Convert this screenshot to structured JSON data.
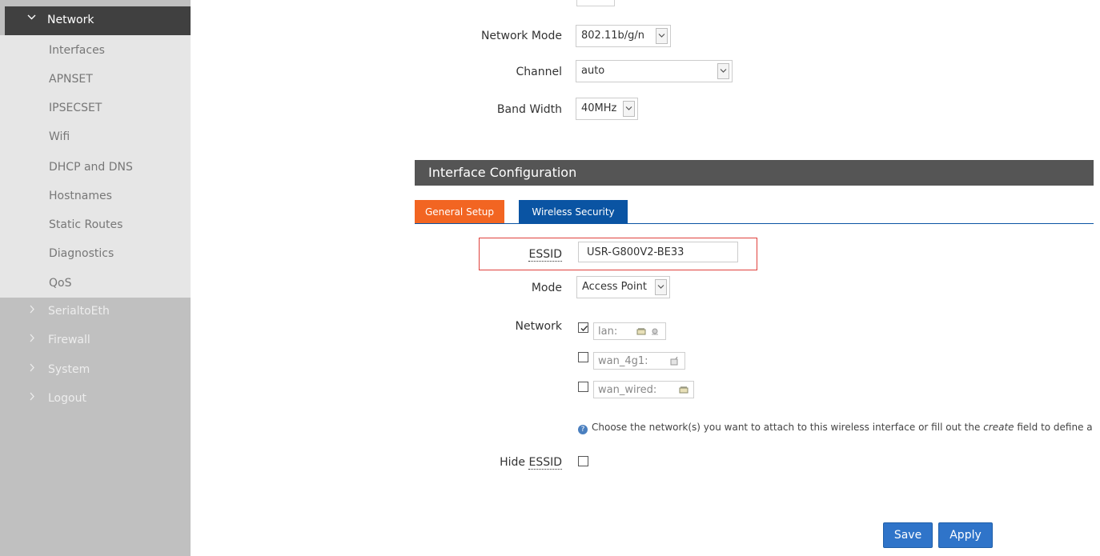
{
  "sidebar": {
    "open_section": {
      "label": "Network"
    },
    "submenu": [
      "Interfaces",
      "APNSET",
      "IPSECSET",
      "Wifi",
      "DHCP and DNS",
      "Hostnames",
      "Static Routes",
      "Diagnostics",
      "QoS"
    ],
    "collapsed_sections": [
      "SerialtoEth",
      "Firewall",
      "System",
      "Logout"
    ]
  },
  "device_settings": {
    "network_mode": {
      "label": "Network Mode",
      "value": "802.11b/g/n"
    },
    "channel": {
      "label": "Channel",
      "value": "auto"
    },
    "band_width": {
      "label": "Band Width",
      "value": "40MHz"
    }
  },
  "interface_config": {
    "title": "Interface Configuration",
    "tabs": [
      {
        "label": "General Setup",
        "active": true
      },
      {
        "label": "Wireless Security",
        "active": false
      }
    ],
    "essid": {
      "label": "ESSID",
      "value": "USR-G800V2-BE33"
    },
    "mode": {
      "label": "Mode",
      "value": "Access Point"
    },
    "network": {
      "label": "Network",
      "options": [
        {
          "name": "lan:",
          "checked": true
        },
        {
          "name": "wan_4g1:",
          "checked": false
        },
        {
          "name": "wan_wired:",
          "checked": false
        }
      ]
    },
    "help": {
      "before": "Choose the network(s) you want to attach to this wireless interface or fill out the ",
      "emphasis": "create",
      "after": " field to define a nev"
    },
    "hide_essid": {
      "label": "Hide ESSID",
      "checked": false
    }
  },
  "actions": {
    "save": "Save",
    "apply": "Apply"
  },
  "colors": {
    "sidebar_bg": "#c0c0c0",
    "submenu_bg": "#e6e6e6",
    "open_section_bg": "#404040",
    "section_header_bg": "#555555",
    "tab_active": "#f26522",
    "tab_inactive": "#0a54a3",
    "button": "#2f74c9",
    "highlight_border": "#e0403c"
  }
}
